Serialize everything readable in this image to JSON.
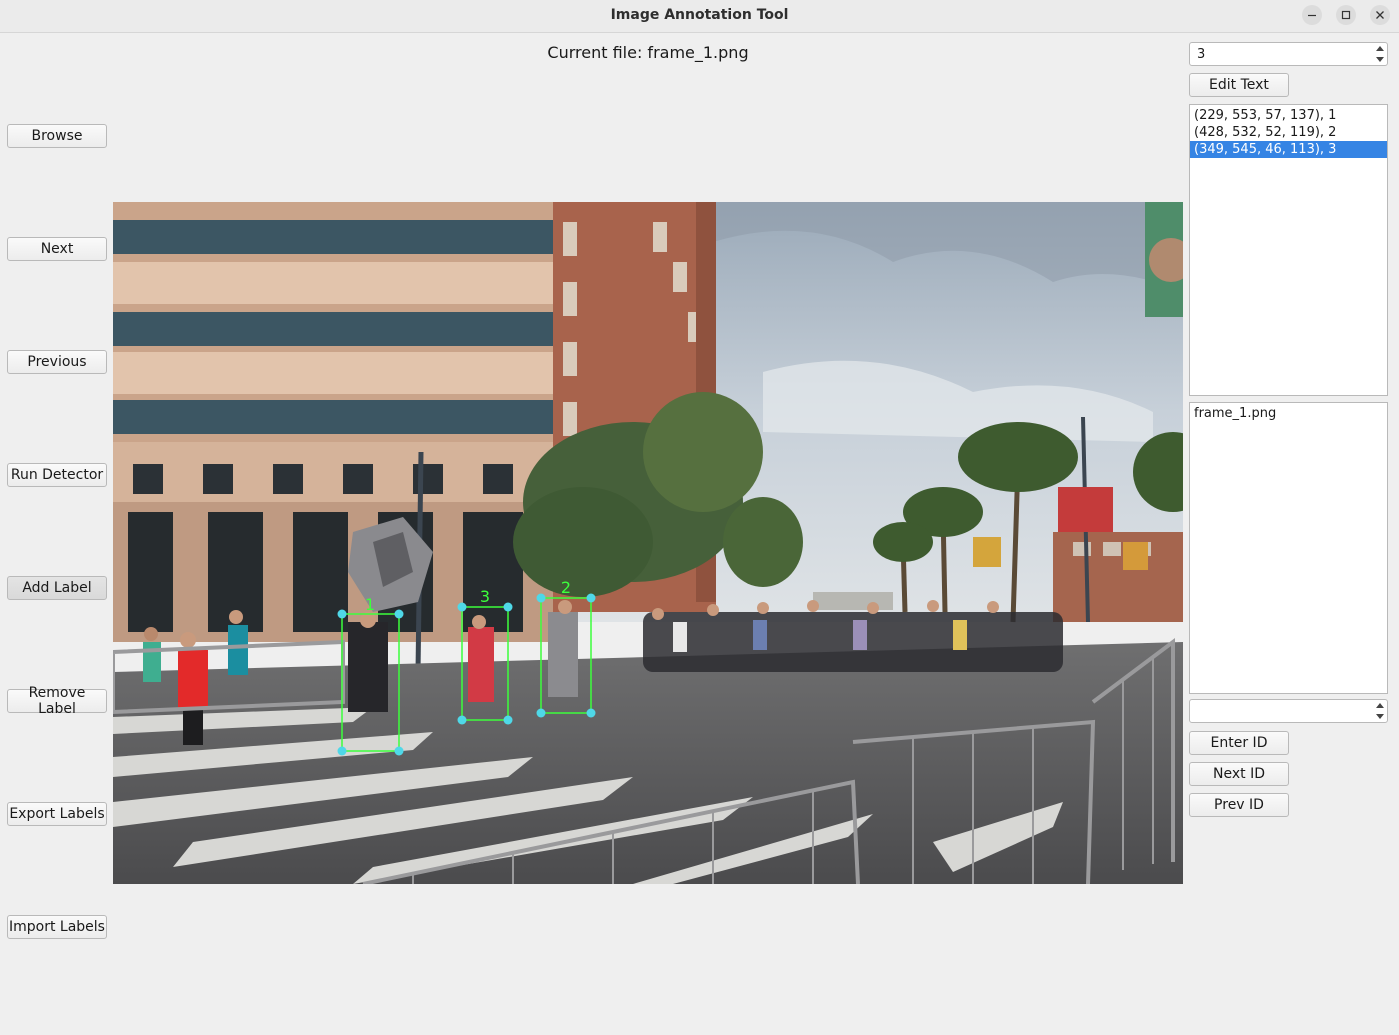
{
  "window": {
    "title": "Image Annotation Tool"
  },
  "header": {
    "current_file": "Current file: frame_1.png"
  },
  "left_buttons": [
    {
      "label": "Browse"
    },
    {
      "label": "Next"
    },
    {
      "label": "Previous"
    },
    {
      "label": "Run Detector"
    },
    {
      "label": "Add Label"
    },
    {
      "label": "Remove Label"
    },
    {
      "label": "Export Labels"
    },
    {
      "label": "Import Labels"
    }
  ],
  "right_panel": {
    "label_spin_value": "3",
    "edit_text_label": "Edit Text",
    "annotations": [
      {
        "text": "(229, 553, 57, 137), 1",
        "selected": false
      },
      {
        "text": "(428, 532, 52, 119), 2",
        "selected": false
      },
      {
        "text": "(349, 545, 46, 113), 3",
        "selected": true
      }
    ],
    "files": [
      "frame_1.png"
    ],
    "id_spin_value": "",
    "enter_id_label": "Enter ID",
    "next_id_label": "Next ID",
    "prev_id_label": "Prev ID"
  },
  "image": {
    "bounding_boxes": [
      {
        "id": "1"
      },
      {
        "id": "2"
      },
      {
        "id": "3"
      }
    ]
  },
  "colors": {
    "selection": "#3584e4",
    "bbox_stroke": "#3cff3c",
    "bbox_handle": "#4fd8e8"
  }
}
